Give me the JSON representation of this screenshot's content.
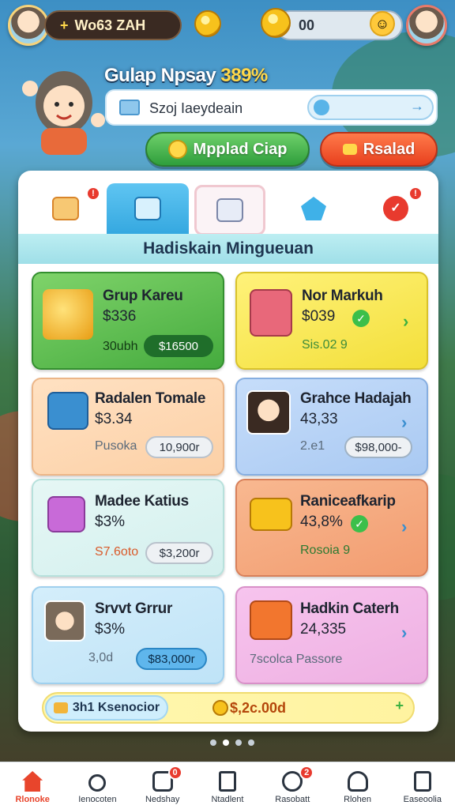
{
  "colors": {
    "accent_green": "#3fb54a",
    "accent_orange": "#f05a28",
    "tab_active": "#35a8e0",
    "nav_active": "#e8452c"
  },
  "topbar": {
    "left_avatar_icon": "avatar-woman-icon",
    "currency_label": "Wo63 ZAH",
    "currency_icon": "plus-icon",
    "medal_icon": "gold-medal-icon",
    "coins_icon": "coin-stack-icon",
    "coins_value": "00",
    "emoji_icon": "smiley-face-icon",
    "right_avatar_icon": "avatar-woman-icon"
  },
  "header": {
    "player_name": "Gulap Npsay",
    "player_pct": "389%",
    "search_icon": "folder-icon",
    "search_text": "Szoj Iaeydeain",
    "search_go_icon": "arrow-right-icon",
    "primary_button_label": "Mpplad Ciap",
    "primary_button_icon": "coins-icon",
    "secondary_button_label": "Rsalad",
    "secondary_button_icon": "heart-icon"
  },
  "tabs": [
    {
      "icon": "gift-letter-icon",
      "badge": "!"
    },
    {
      "icon": "image-edit-icon",
      "badge": ""
    },
    {
      "icon": "chat-face-icon",
      "badge": ""
    },
    {
      "icon": "blue-gem-icon",
      "badge": ""
    },
    {
      "icon": "red-check-icon",
      "badge": "!"
    }
  ],
  "section": {
    "title": "Hadiskain Mingueuan"
  },
  "cards": [
    {
      "title": "Grup Kareu",
      "price": "$336",
      "sub": "30ubh",
      "button": "$16500",
      "art_icon": "gold-coin-pile-icon",
      "theme": "green"
    },
    {
      "title": "Nor Markuh",
      "price": "$039",
      "sub": "Sis.02 9",
      "button": "",
      "art_icon": "magic-book-icon",
      "theme": "yellow"
    },
    {
      "title": "Radalen Tomale",
      "price": "$3.34",
      "sub": "Pusoka",
      "button": "10,900r",
      "art_icon": "treasure-box-icon",
      "theme": "peach"
    },
    {
      "title": "Grahce Hadajah",
      "price": "43,33",
      "sub": "2.e1",
      "button": "$98,000-",
      "art_icon": "girl-portrait-icon",
      "theme": "blue"
    },
    {
      "title": "Madee Katius",
      "price": "$3%",
      "sub": "S7.6oto",
      "button": "$3,200r",
      "art_icon": "gift-box-icon",
      "theme": "mint"
    },
    {
      "title": "Raniceafkarip",
      "price": "43,8%",
      "sub": "Rosoia 9",
      "button": "",
      "art_icon": "gold-bars-icon",
      "theme": "orange"
    },
    {
      "title": "Srvvt Grrur",
      "price": "$3%",
      "sub": "3,0d",
      "button": "$83,000r",
      "art_icon": "woman-portrait-icon",
      "theme": "lightblue"
    },
    {
      "title": "Hadkin Caterh",
      "price": "24,335",
      "sub": "7scolca Passore",
      "button": "",
      "art_icon": "treasure-chest-icon",
      "theme": "pink"
    }
  ],
  "bonus": {
    "left_label": "3h1 Ksenocior",
    "left_icon": "ticket-icon",
    "right_value": "$,2c.00d",
    "right_icon": "coin-icon",
    "add_icon": "plus-arrow-icon"
  },
  "bottom_nav": [
    {
      "label": "Rlonoke",
      "icon": "home-icon",
      "badge": ""
    },
    {
      "label": "Ienocoten",
      "icon": "search-icon",
      "badge": ""
    },
    {
      "label": "Nedshay",
      "icon": "chat-icon",
      "badge": "0"
    },
    {
      "label": "Ntadlent",
      "icon": "document-icon",
      "badge": ""
    },
    {
      "label": "Rasobatt",
      "icon": "emoji-icon",
      "badge": "2"
    },
    {
      "label": "Rlohen",
      "icon": "user-icon",
      "badge": ""
    },
    {
      "label": "Easeoolia",
      "icon": "settings-list-icon",
      "badge": ""
    }
  ]
}
